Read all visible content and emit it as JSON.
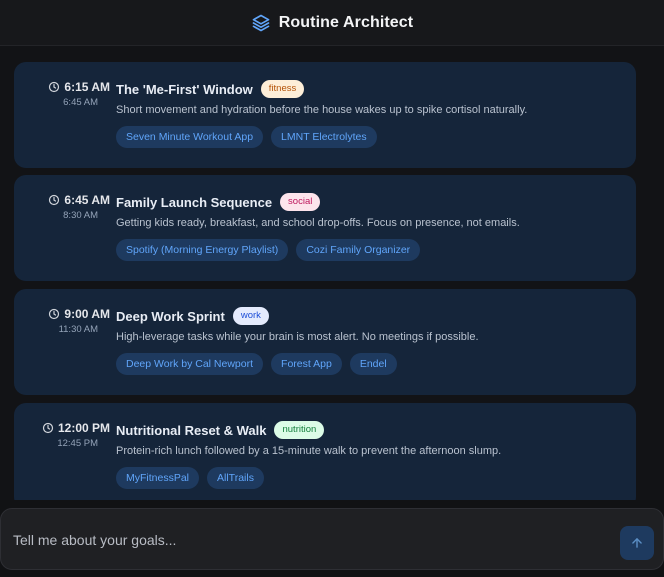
{
  "app": {
    "title": "Routine Architect",
    "logo_icon": "layers-icon",
    "accent": "#60a5fa"
  },
  "schedule": [
    {
      "start": "6:15 AM",
      "end": "6:45 AM",
      "title": "The 'Me-First' Window",
      "tag": "fitness",
      "description": "Short movement and hydration before the house wakes up to spike cortisol naturally.",
      "resources": [
        "Seven Minute Workout App",
        "LMNT Electrolytes"
      ]
    },
    {
      "start": "6:45 AM",
      "end": "8:30 AM",
      "title": "Family Launch Sequence",
      "tag": "social",
      "description": "Getting kids ready, breakfast, and school drop-offs. Focus on presence, not emails.",
      "resources": [
        "Spotify (Morning Energy Playlist)",
        "Cozi Family Organizer"
      ]
    },
    {
      "start": "9:00 AM",
      "end": "11:30 AM",
      "title": "Deep Work Sprint",
      "tag": "work",
      "description": "High-leverage tasks while your brain is most alert. No meetings if possible.",
      "resources": [
        "Deep Work by Cal Newport",
        "Forest App",
        "Endel"
      ]
    },
    {
      "start": "12:00 PM",
      "end": "12:45 PM",
      "title": "Nutritional Reset & Walk",
      "tag": "nutrition",
      "description": "Protein-rich lunch followed by a 15-minute walk to prevent the afternoon slump.",
      "resources": [
        "MyFitnessPal",
        "AllTrails"
      ]
    }
  ],
  "composer": {
    "placeholder": "Tell me about your goals...",
    "send_icon": "arrow-up-icon"
  }
}
